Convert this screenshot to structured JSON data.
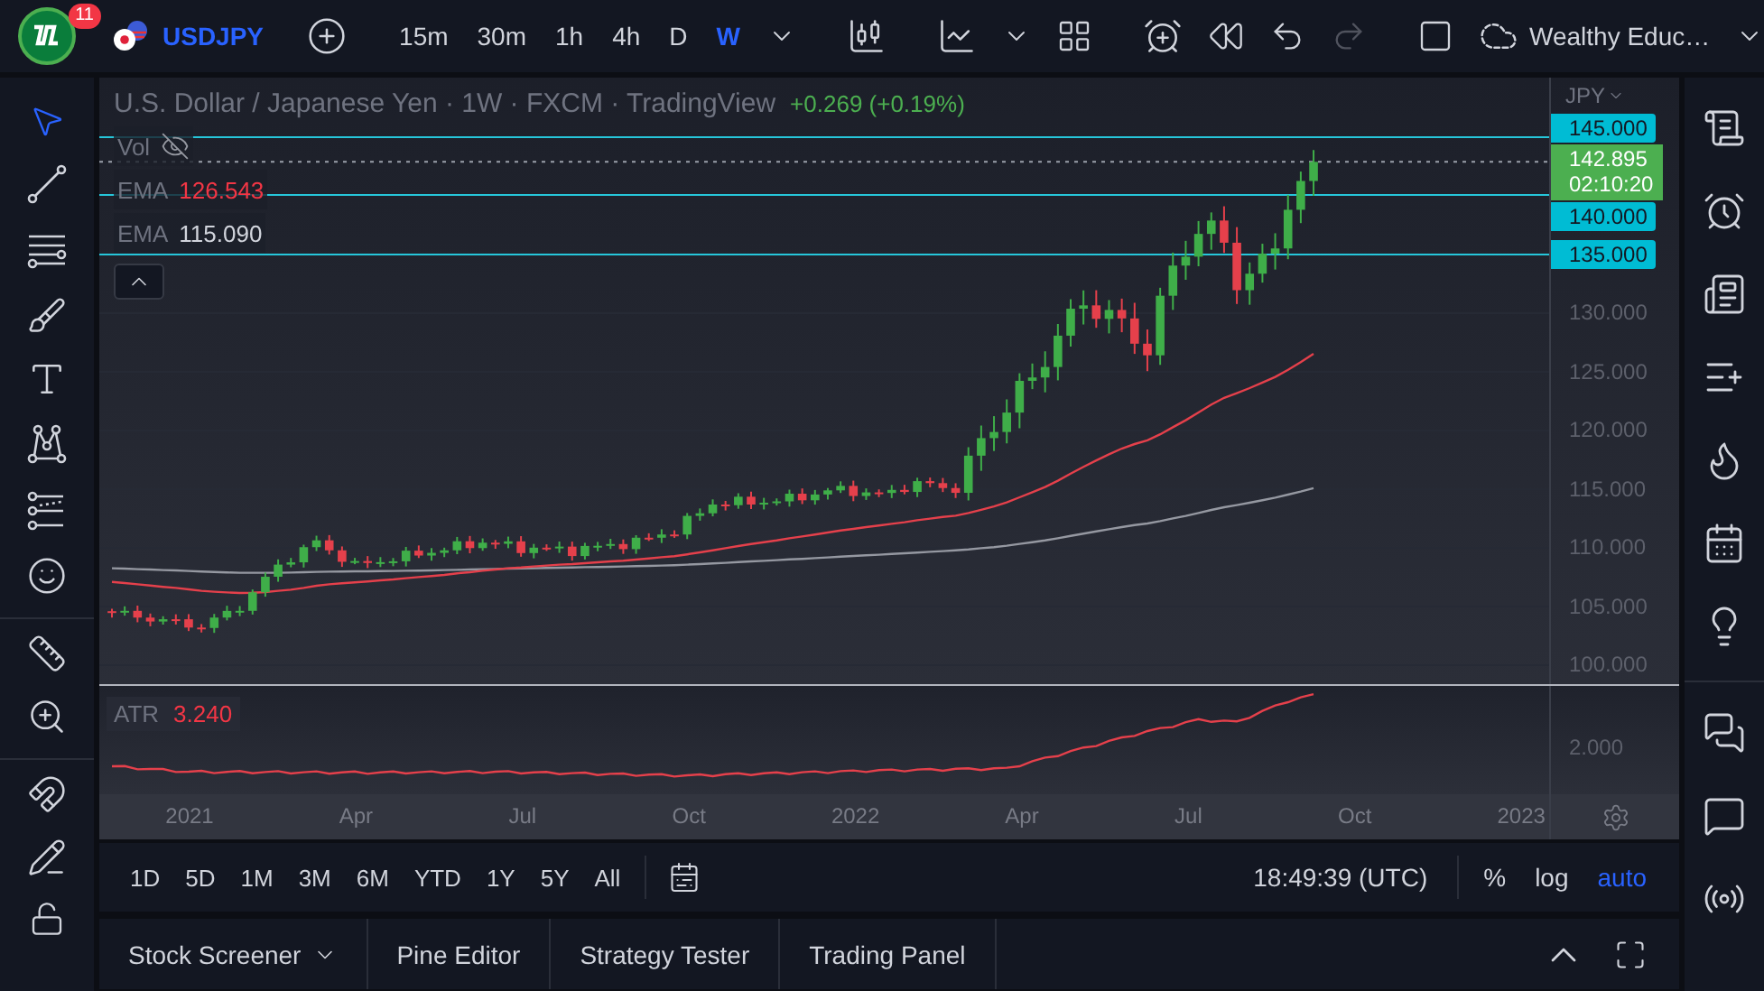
{
  "top_bar": {
    "notification_count": "11",
    "symbol": "USDJPY",
    "intervals": [
      {
        "label": "15m",
        "selected": false
      },
      {
        "label": "30m",
        "selected": false
      },
      {
        "label": "1h",
        "selected": false
      },
      {
        "label": "4h",
        "selected": false
      },
      {
        "label": "D",
        "selected": false
      },
      {
        "label": "W",
        "selected": true
      }
    ],
    "layout_name": "Wealthy Educ…"
  },
  "left_toolbar": {
    "tool_groups": [
      [
        {
          "kind": "cursor",
          "selected": true
        },
        {
          "kind": "trend-line",
          "selected": false
        },
        {
          "kind": "fib",
          "selected": false
        },
        {
          "kind": "brush",
          "selected": false
        },
        {
          "kind": "text",
          "selected": false
        },
        {
          "kind": "pattern",
          "selected": false
        },
        {
          "kind": "prediction",
          "selected": false
        },
        {
          "kind": "emoji",
          "selected": false
        }
      ],
      [
        {
          "kind": "ruler",
          "selected": false
        },
        {
          "kind": "zoom",
          "selected": false
        }
      ],
      [
        {
          "kind": "magnet",
          "selected": false
        },
        {
          "kind": "drawing-lock",
          "selected": false
        },
        {
          "kind": "lock",
          "selected": false
        }
      ]
    ]
  },
  "chart": {
    "title": "U.S. Dollar / Japanese Yen · 1W · FXCM · TradingView",
    "change": "+0.269 (+0.19%)",
    "legend": [
      {
        "kind": "volume",
        "label": "Vol",
        "hidden": true
      },
      {
        "kind": "ema",
        "label": "EMA",
        "value": "126.543",
        "color": "#f23645"
      },
      {
        "kind": "ema",
        "label": "EMA",
        "value": "115.090",
        "color": "#d1d4dc"
      }
    ],
    "price_axis": {
      "currency": "JPY",
      "levels": [
        "145.000",
        "140.000",
        "135.000"
      ],
      "last_price": "142.895",
      "countdown": "02:10:20",
      "ticks": [
        "130.000",
        "125.000",
        "120.000",
        "115.000",
        "110.000",
        "105.000",
        "100.000"
      ]
    },
    "atr": {
      "label": "ATR",
      "value": "3.240",
      "tick": "2.000"
    },
    "time_axis": [
      "2021",
      "Apr",
      "Jul",
      "Oct",
      "2022",
      "Apr",
      "Jul",
      "Oct",
      "2023"
    ]
  },
  "range_bar": {
    "ranges": [
      "1D",
      "5D",
      "1M",
      "3M",
      "6M",
      "YTD",
      "1Y",
      "5Y",
      "All"
    ],
    "clock": "18:49:39 (UTC)",
    "scale_options": [
      {
        "label": "%",
        "selected": false
      },
      {
        "label": "log",
        "selected": false
      },
      {
        "label": "auto",
        "selected": true
      }
    ]
  },
  "bottom_panel": {
    "tabs": [
      {
        "label": "Stock Screener",
        "has_menu": true
      },
      {
        "label": "Pine Editor",
        "has_menu": false
      },
      {
        "label": "Strategy Tester",
        "has_menu": false
      },
      {
        "label": "Trading Panel",
        "has_menu": false
      }
    ]
  },
  "right_sidebar": {
    "groups": [
      [
        {
          "kind": "watchlist"
        },
        {
          "kind": "alerts"
        },
        {
          "kind": "news"
        },
        {
          "kind": "data-window"
        },
        {
          "kind": "hotlist"
        },
        {
          "kind": "calendar"
        },
        {
          "kind": "ideas"
        }
      ],
      [
        {
          "kind": "chats"
        },
        {
          "kind": "private-chats"
        },
        {
          "kind": "streams"
        }
      ]
    ]
  }
}
